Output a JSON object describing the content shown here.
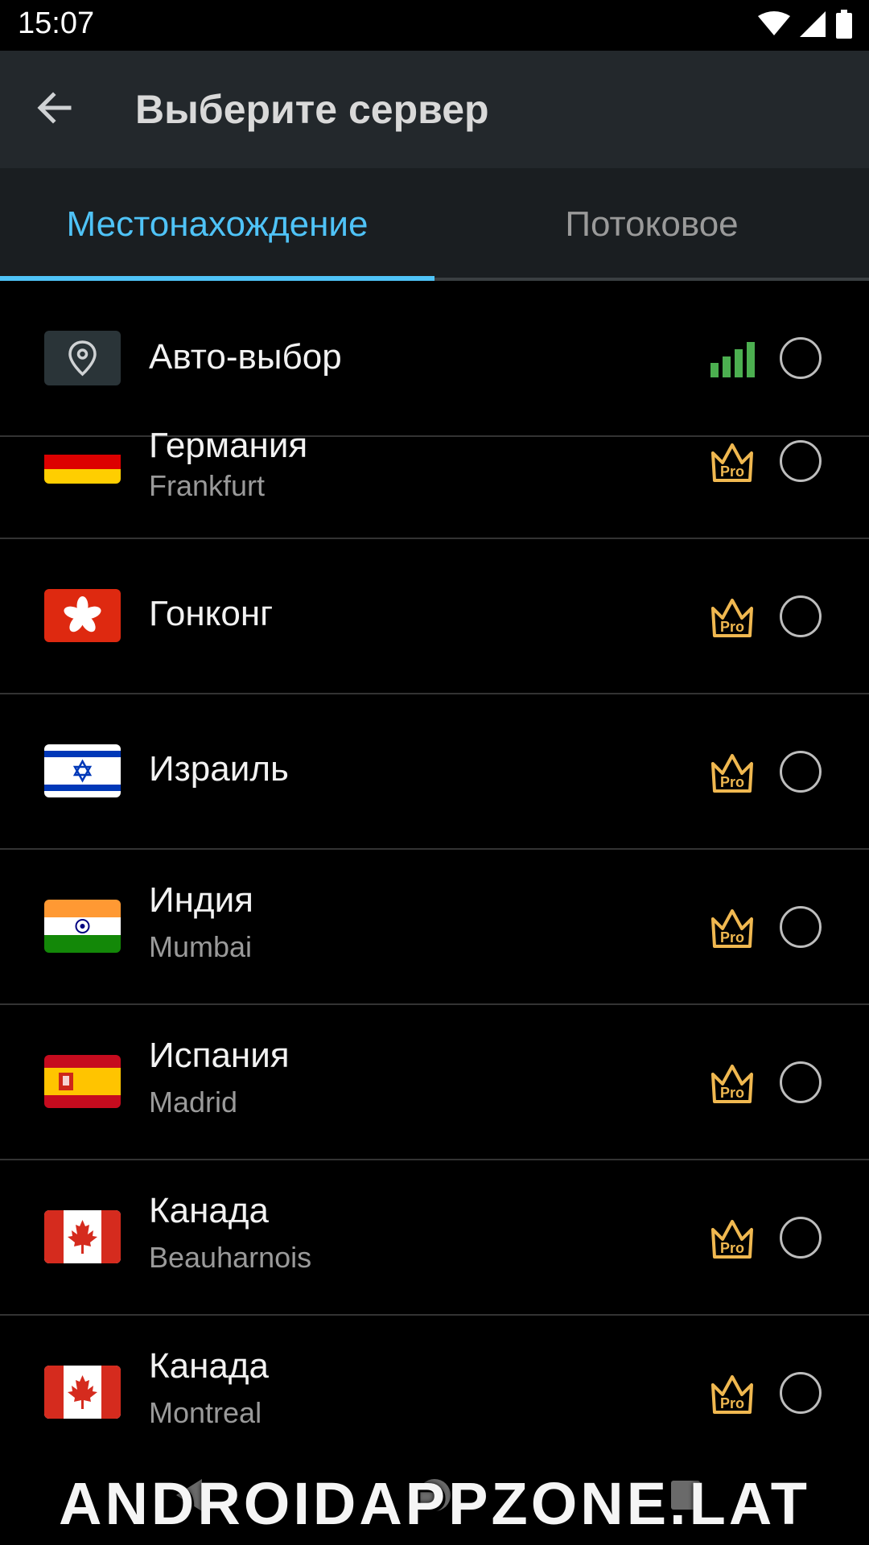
{
  "status_bar": {
    "time": "15:07"
  },
  "app_bar": {
    "title": "Выберите сервер"
  },
  "tabs": [
    {
      "label": "Местонахождение",
      "active": true
    },
    {
      "label": "Потоковое",
      "active": false
    }
  ],
  "auto_select": {
    "label": "Авто-выбор"
  },
  "servers": [
    {
      "country": "Германия",
      "city": "Frankfurt",
      "flag": "germany-flag",
      "badge": "Pro"
    },
    {
      "country": "Гонконг",
      "city": "",
      "flag": "hong-kong-flag",
      "badge": "Pro"
    },
    {
      "country": "Израиль",
      "city": "",
      "flag": "israel-flag",
      "badge": "Pro"
    },
    {
      "country": "Индия",
      "city": "Mumbai",
      "flag": "india-flag",
      "badge": "Pro"
    },
    {
      "country": "Испания",
      "city": "Madrid",
      "flag": "spain-flag",
      "badge": "Pro"
    },
    {
      "country": "Канада",
      "city": "Beauharnois",
      "flag": "canada-flag",
      "badge": "Pro"
    },
    {
      "country": "Канада",
      "city": "Montreal",
      "flag": "canada-flag",
      "badge": "Pro"
    }
  ],
  "colors": {
    "accent": "#4fc3f7",
    "pro_gold": "#f0b850",
    "signal_green": "#4caf50"
  },
  "watermark": "ANDROIDAPPZONE.LAT"
}
